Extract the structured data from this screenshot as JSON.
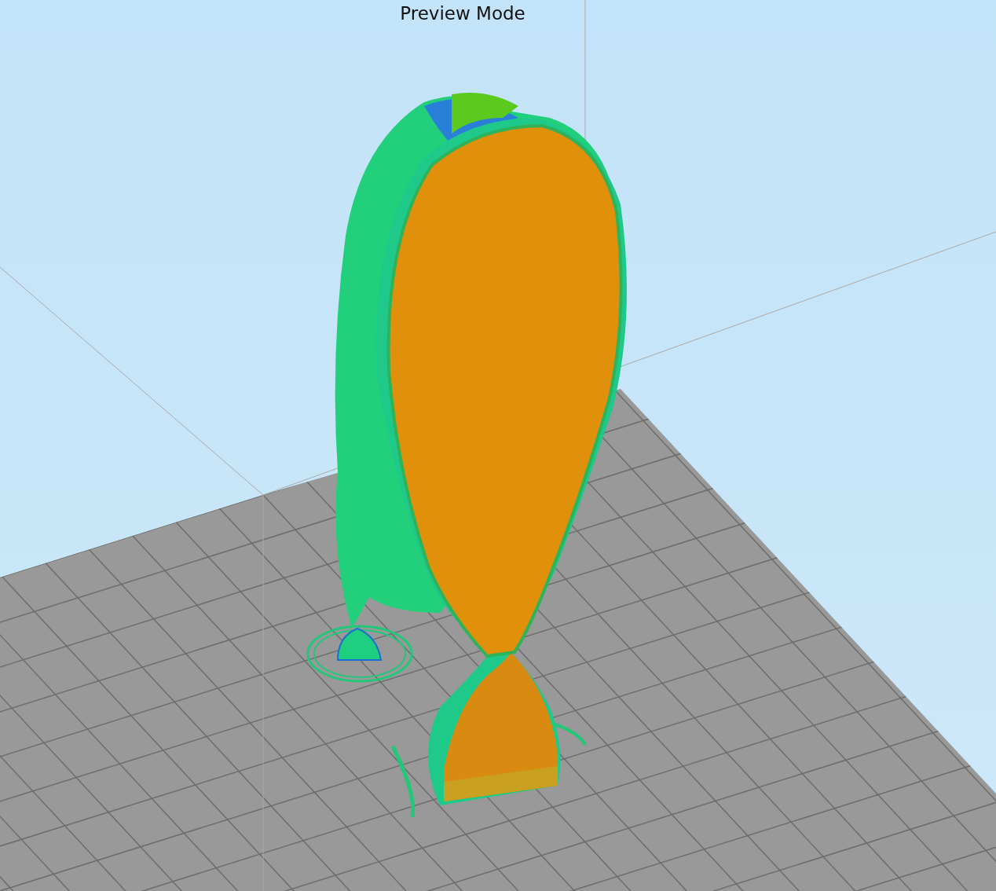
{
  "viewport": {
    "title": "Preview Mode"
  }
}
